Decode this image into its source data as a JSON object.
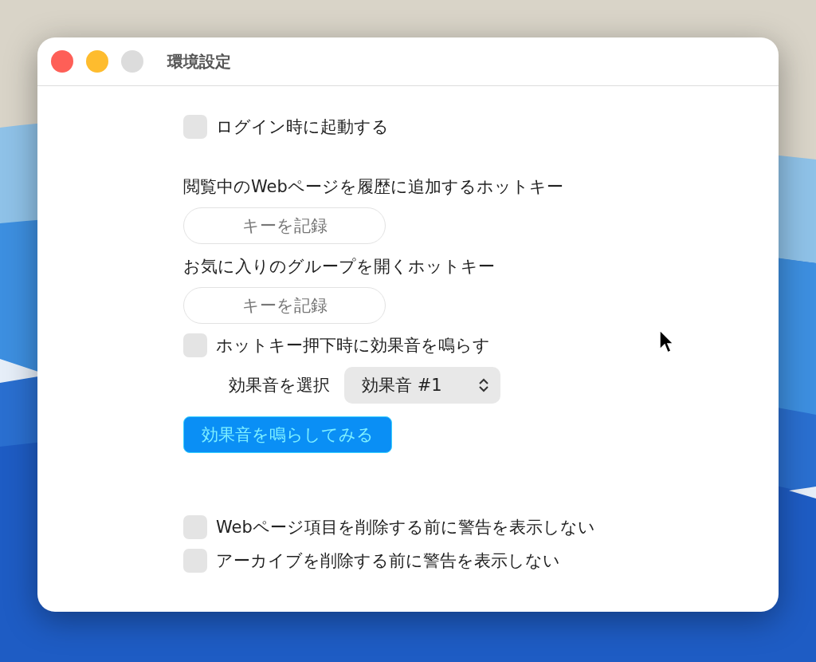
{
  "window": {
    "title": "環境設定"
  },
  "settings": [
    {
      "kind": "checkbox",
      "label": "ログイン時に起動する",
      "checked": false
    },
    {
      "kind": "hotkey",
      "label": "閲覧中のWebページを履歴に追加するホットキー",
      "button": "キーを記録"
    },
    {
      "kind": "hotkey",
      "label": "お気に入りのグループを開くホットキー",
      "button": "キーを記録"
    },
    {
      "kind": "checkbox",
      "label": "ホットキー押下時に効果音を鳴らす",
      "checked": false
    },
    {
      "kind": "select",
      "label": "効果音を選択",
      "value": "効果音 #1"
    },
    {
      "kind": "button",
      "label": "効果音を鳴らしてみる"
    },
    {
      "kind": "checkbox",
      "label": "Webページ項目を削除する前に警告を表示しない",
      "checked": false
    },
    {
      "kind": "checkbox",
      "label": "アーカイブを削除する前に警告を表示しない",
      "checked": false
    }
  ]
}
